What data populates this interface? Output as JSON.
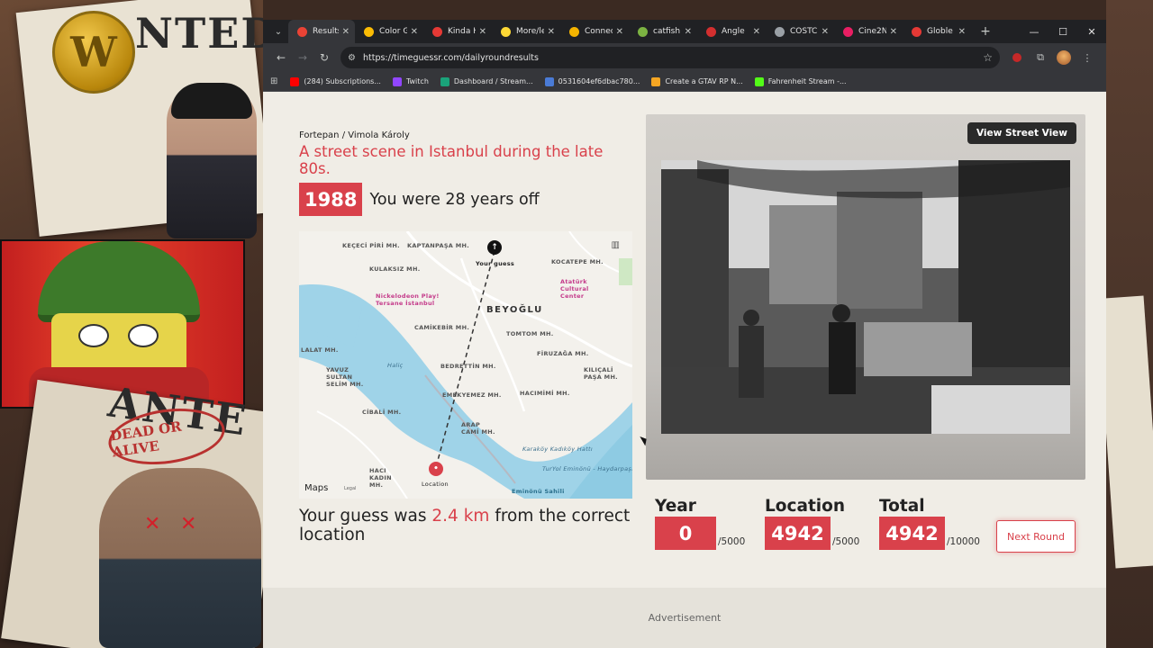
{
  "overlay": {
    "poster_top_text": "NTED",
    "poster_bottom_text": "ANTE",
    "dead_stamp": "DEAD OR ALIVE",
    "coin_letter": "W"
  },
  "browser": {
    "tabs": [
      {
        "title": "Results",
        "active": true,
        "favicon_color": "#ea4335",
        "icon": "globe-favicon"
      },
      {
        "title": "Color G",
        "active": false,
        "favicon_color": "#fbbc04",
        "icon": "color-wheel-favicon"
      },
      {
        "title": "Kinda H",
        "active": false,
        "favicon_color": "#e53935",
        "icon": "bookmark-favicon"
      },
      {
        "title": "More/le",
        "active": false,
        "favicon_color": "#fdd835",
        "icon": "arrow-favicon"
      },
      {
        "title": "Connec",
        "active": false,
        "favicon_color": "#f4b400",
        "icon": "grid-favicon"
      },
      {
        "title": "catfish",
        "active": false,
        "favicon_color": "#7cb342",
        "icon": "leaf-favicon"
      },
      {
        "title": "Angle",
        "active": false,
        "favicon_color": "#d32f2f",
        "icon": "square-favicon"
      },
      {
        "title": "COSTC",
        "active": false,
        "favicon_color": "#9aa0a6",
        "icon": "globe-favicon"
      },
      {
        "title": "Cine2N",
        "active": false,
        "favicon_color": "#e91e63",
        "icon": "grid-favicon"
      },
      {
        "title": "Globle",
        "active": false,
        "favicon_color": "#e53935",
        "icon": "globe-favicon"
      }
    ],
    "url": "https://timeguessr.com/dailyroundresults",
    "bookmarks": [
      {
        "label": "(284) Subscriptions...",
        "color": "#ff0000"
      },
      {
        "label": "Twitch",
        "color": "#9146ff"
      },
      {
        "label": "Dashboard / Stream...",
        "color": "#1aa37a"
      },
      {
        "label": "0531604ef6dbac780...",
        "color": "#4a7bd6"
      },
      {
        "label": "Create a GTAV RP N...",
        "color": "#f5a623"
      },
      {
        "label": "Fahrenheit Stream -...",
        "color": "#53fc18"
      }
    ]
  },
  "result": {
    "credit": "Fortepan / Vimola Károly",
    "headline": "A street scene in Istanbul during the late 80s.",
    "year": "1988",
    "year_off": "You were 28 years off",
    "distance_pre": "Your guess was",
    "distance_value": "2.4 km",
    "distance_post": "from the correct location",
    "view_street_view": "View Street View"
  },
  "map": {
    "labels": {
      "kaptanpasa": "KAPTANPAŞA MH.",
      "kececi": "KEÇECİ PİRİ MH.",
      "kulaksiz": "KULAKSIZ MH.",
      "kocatepe": "KOCATEPE MH.",
      "ataturk": "Atatürk Cultural Center",
      "nickelodeon": "Nickelodeon Play! Tersane İstanbul",
      "beyoglu": "BEYOĞLU",
      "camikebir": "CAMİKEBİR MH.",
      "tomtom": "TOMTOM MH.",
      "lalat": "LALAT MH.",
      "firuzaga": "FİRUZAĞA MH.",
      "yavuz": "YAVUZ SULTAN SELİM MH.",
      "halic": "Haliç",
      "bedrettin": "BEDRETTİN MH.",
      "kilicali": "KILIÇALİ PAŞA MH.",
      "emekyemez": "EMEKYEMEZ MH.",
      "hacimimi": "HACIMİMİ MH.",
      "cibali": "CİBALİ MH.",
      "arap": "ARAP CAMİ MH.",
      "haci": "HACI KADIN MH.",
      "karakoy": "Karaköy Kadıköy Hattı",
      "tuyol": "TurYol Eminönü - Haydarpaşa Hattı",
      "eminonu": "Eminönü Sahili",
      "your_guess": "Your guess",
      "location": "Location",
      "maps": "Maps",
      "legal": "Legal"
    }
  },
  "scores": {
    "year": {
      "label": "Year",
      "value": "0",
      "max": "/5000"
    },
    "location": {
      "label": "Location",
      "value": "4942",
      "max": "/5000"
    },
    "total": {
      "label": "Total",
      "value": "4942",
      "max": "/10000"
    }
  },
  "next_round": "Next Round",
  "advertisement": "Advertisement",
  "colors": {
    "accent": "#d9414b",
    "page_bg": "#f0ede6"
  }
}
